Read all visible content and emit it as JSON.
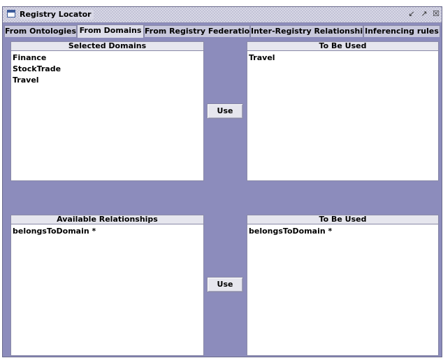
{
  "window": {
    "title": "Registry Locator",
    "controls": [
      "restore-icon",
      "maximize-icon",
      "close-icon"
    ]
  },
  "tabs": [
    {
      "label": "From Ontologies",
      "active": false
    },
    {
      "label": "From Domains",
      "active": true
    },
    {
      "label": "From Registry Federation",
      "active": false
    },
    {
      "label": "Inter-Registry Relationships",
      "active": false
    },
    {
      "label": "Inferencing rules",
      "active": false
    }
  ],
  "domains": {
    "selected": {
      "header": "Selected Domains",
      "items": [
        "Finance",
        "StockTrade",
        "Travel"
      ]
    },
    "use_button": "Use",
    "to_be_used": {
      "header": "To Be Used",
      "items": [
        "Travel"
      ]
    }
  },
  "relationships": {
    "available": {
      "header": "Available Relationships",
      "items": [
        "belongsToDomain *"
      ]
    },
    "use_button": "Use",
    "to_be_used": {
      "header": "To Be Used",
      "items": [
        "belongsToDomain *"
      ]
    }
  },
  "colors": {
    "background": "#8c8cbc",
    "panel_header": "#e6e6ee",
    "list_background": "#ffffff",
    "active_tab": "#dedeea",
    "inactive_tab": "#c8c8dc"
  }
}
